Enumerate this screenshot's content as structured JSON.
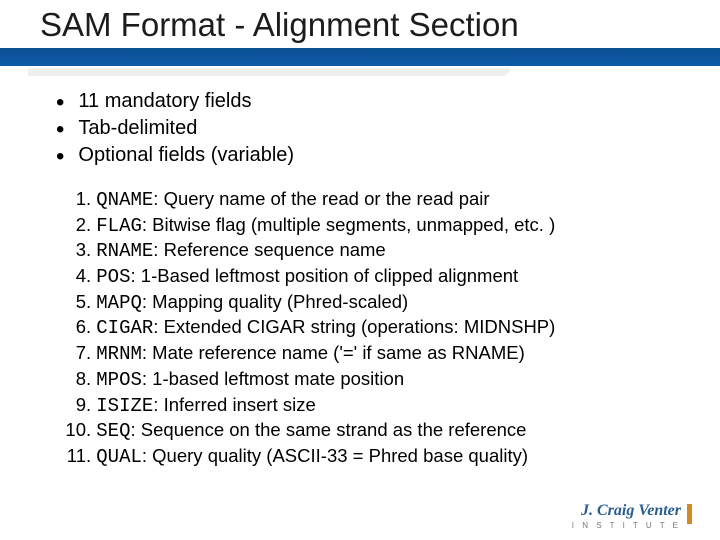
{
  "title": "SAM Format - Alignment Section",
  "bullets": [
    "11 mandatory fields",
    "Tab-delimited",
    "Optional fields (variable)"
  ],
  "fields": [
    {
      "n": "1",
      "name": "QNAME",
      "desc": "Query name of the read or the read pair"
    },
    {
      "n": "2",
      "name": "FLAG",
      "desc": "Bitwise flag (multiple segments, unmapped, etc. )"
    },
    {
      "n": "3",
      "name": "RNAME",
      "desc": "Reference sequence name"
    },
    {
      "n": "4",
      "name": "POS",
      "desc": "1-Based leftmost position of clipped alignment"
    },
    {
      "n": "5",
      "name": "MAPQ",
      "desc": "Mapping quality (Phred-scaled)"
    },
    {
      "n": "6",
      "name": "CIGAR",
      "desc": "Extended CIGAR string (operations: MIDNSHP)"
    },
    {
      "n": "7",
      "name": "MRNM",
      "desc": "Mate reference name ('=' if same as RNAME)"
    },
    {
      "n": "8",
      "name": "MPOS",
      "desc": "1-based leftmost mate position"
    },
    {
      "n": "9",
      "name": "ISIZE",
      "desc": "Inferred insert size"
    },
    {
      "n": "10",
      "name": "SEQ",
      "desc": "Sequence on the same strand as the reference"
    },
    {
      "n": "11",
      "name": "QUAL",
      "desc": "Query quality (ASCII-33 = Phred base quality)"
    }
  ],
  "footer": {
    "logo_text": "J. Craig Venter",
    "logo_sub": "I N S T I T U T E"
  }
}
